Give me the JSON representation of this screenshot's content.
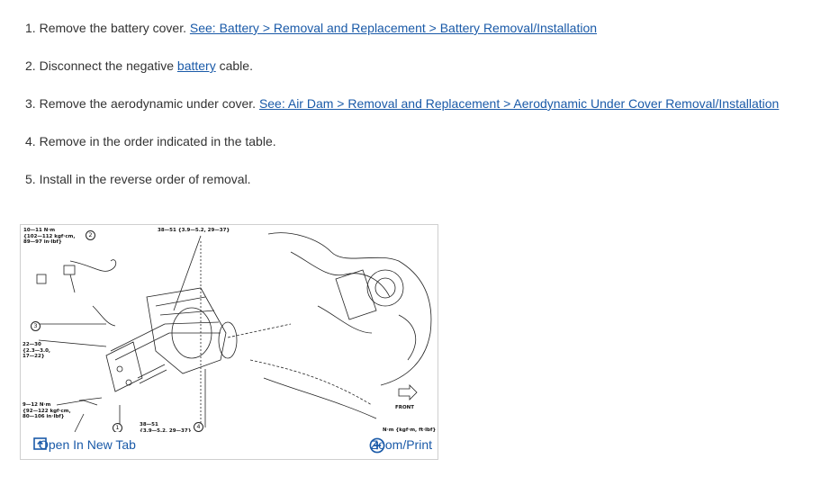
{
  "steps": [
    {
      "num": "1.",
      "text": "Remove the battery cover.",
      "link": "See: Battery > Removal and Replacement > Battery Removal/Installation"
    },
    {
      "num": "2.",
      "text_before": "Disconnect the negative",
      "link": "battery",
      "text_after": "cable."
    },
    {
      "num": "3.",
      "text": "Remove the aerodynamic under cover.",
      "link": "See: Air Dam > Removal and Replacement > Aerodynamic Under Cover Removal/Installation"
    },
    {
      "num": "4.",
      "text": "Remove in the order indicated in the table."
    },
    {
      "num": "5.",
      "text": "Install in the reverse order of removal."
    }
  ],
  "figure": {
    "torque_top_left": "10—11 N·m\n{102—112 kgf·cm,\n89—97 in·lbf}",
    "torque_top_center": "38—51 {3.9—5.2, 29—37}",
    "torque_left_mid": "22—30\n{2.3—3.0,\n17—22}",
    "torque_left_bottom": "9—12 N·m\n{92—122 kgf·cm,\n80—106 in·lbf}",
    "torque_bottom_center": "38—51\n{3.9—5.2, 29—37}",
    "callouts": [
      "1",
      "2",
      "3",
      "4"
    ],
    "front_label": "FRONT",
    "units_note": "N·m {kgf·m, ft·lbf}",
    "open_tab_label": "Open In New Tab",
    "zoom_label": "Zoom/Print",
    "icons": {
      "open_tab": "open-in-new-tab-icon",
      "zoom": "zoom-plus-icon"
    },
    "link_color": "#1a5aa8"
  }
}
